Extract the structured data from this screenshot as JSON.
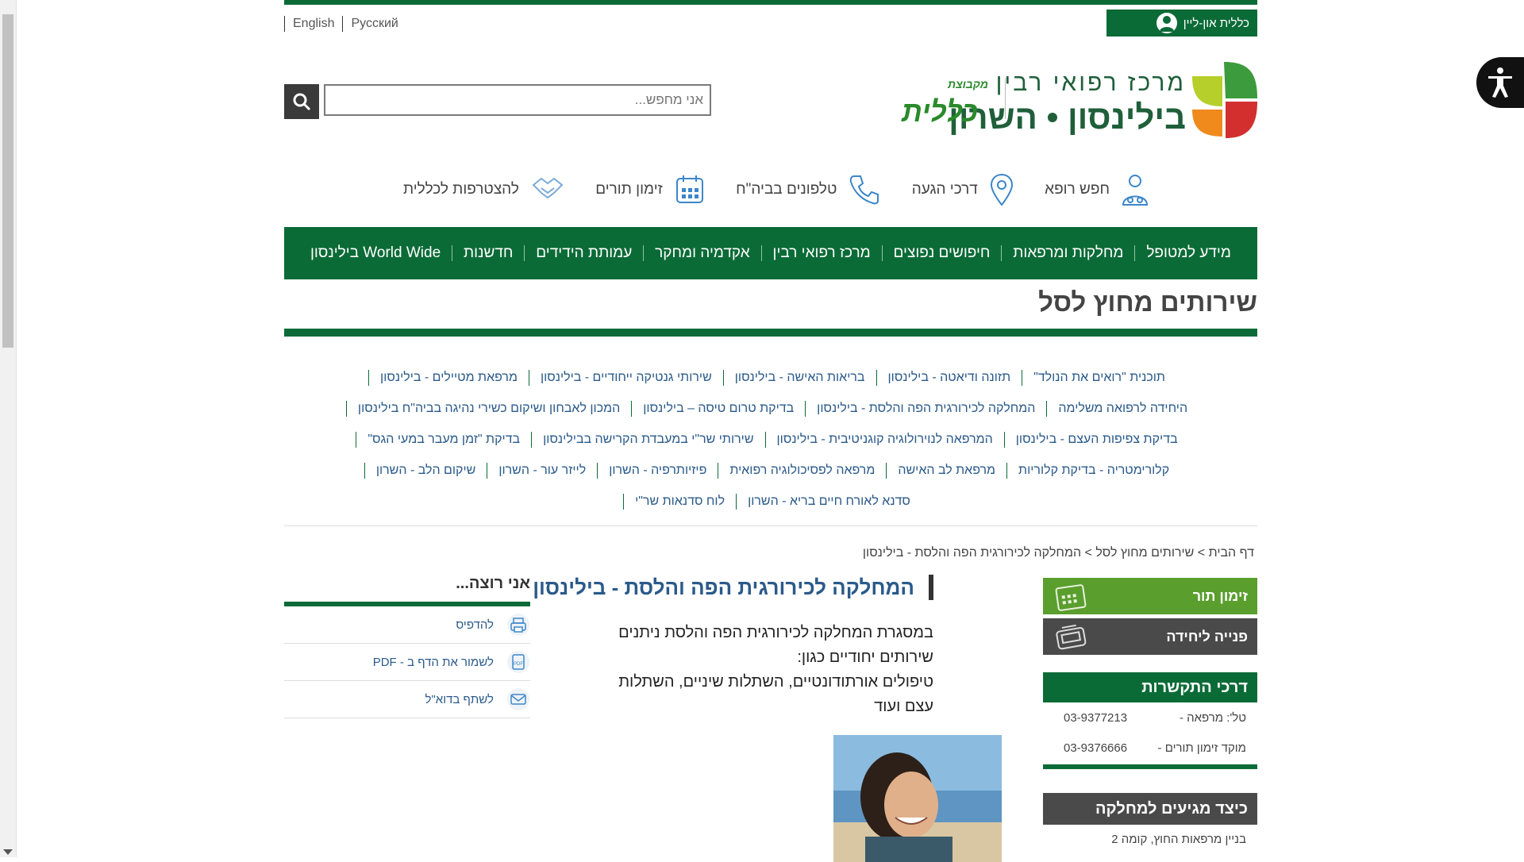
{
  "header": {
    "languages": [
      "English",
      "Русский"
    ],
    "online_label": "כללית און-ליין",
    "logo_line1": "מרכז רפואי רבין",
    "logo_line2": "בילינסון • השרון",
    "clalit_group_small": "מקבוצת",
    "clalit_name": "כללית",
    "search_placeholder": "אני מחפש..."
  },
  "quicklinks": [
    {
      "label": "להצטרפות לכללית",
      "icon": "handshake-icon"
    },
    {
      "label": "זימון תורים",
      "icon": "calendar-icon"
    },
    {
      "label": "טלפונים בביה\"ח",
      "icon": "phone-icon"
    },
    {
      "label": "דרכי הגעה",
      "icon": "location-pin-icon"
    },
    {
      "label": "חפש רופא",
      "icon": "doctor-icon"
    }
  ],
  "nav": [
    "מידע למטופל",
    "מחלקות ומרפאות",
    "חיפושים נפוצים",
    "מרכז רפואי רבין",
    "אקדמיה ומחקר",
    "עמותת הידידים",
    "חדשנות",
    "בילינסון World Wide"
  ],
  "section_title": "שירותים מחוץ לסל",
  "services": [
    [
      "תוכנית \"רואים את הנולד\"",
      "תזונה ודיאטה - בילינסון",
      "בריאות האישה - בילינסון",
      "שירותי גנטיקה ייחודיים - בילינסון",
      "מרפאת מטיילים - בילינסון"
    ],
    [
      "היחידה לרפואה משלימה",
      "המחלקה לכירורגית הפה והלסת - בילינסון",
      "בדיקת טרום טיסה – בילינסון",
      "המכון לאבחון ושיקום כשירי נהיגה בביה\"ח בילינסון"
    ],
    [
      "בדיקת צפיפות העצם - בילינסון",
      "המרפאה לנוירולוגיה קוגניטיבית - בילינסון",
      "שירותי שר\"י במעבדת הקרישה בבילינסון",
      "בדיקת \"זמן מעבר במעי הגס\""
    ],
    [
      "קלורימטריה - בדיקת קלוריות",
      "מרפאת לב האישה",
      "מרפאה לפסיכולוגיה רפואית",
      "פיזיותרפיה - השרון",
      "לייזר עור - השרון",
      "שיקום הלב - השרון"
    ],
    [
      "סדנא לאורח חיים בריא - השרון",
      "לוח סדנאות שר\"י"
    ]
  ],
  "breadcrumb": "דף הבית > שירותים מחוץ לסל > המחלקה לכירורגית הפה והלסת - בילינסון",
  "sidebar_right": {
    "appointment_label": "זימון תור",
    "contact_unit_label": "פנייה ליחידה",
    "contact_title": "דרכי התקשרות",
    "contacts": [
      {
        "label": "טל': מרפאה -",
        "value": "03-9377213"
      },
      {
        "label": "מוקד זימון תורים -",
        "value": "03-9376666"
      }
    ],
    "arrive_title": "כיצד מגיעים למחלקה",
    "arrive_text": "בניין מרפאות החוץ, קומה 2"
  },
  "content": {
    "title": "המחלקה לכירורגית הפה והלסת - בילינסון",
    "para1": "במסגרת המחלקה לכירורגית הפה והלסת ניתנים שירותים יחודיים כגון:",
    "para2": "טיפולים אורתודונטיים, השתלות שיניים, השתלות עצם ועוד"
  },
  "sidebar_left": {
    "title": "אני רוצה...",
    "items": [
      {
        "label": "להדפיס",
        "icon": "printer-icon"
      },
      {
        "label": "לשמור את הדף ב - PDF",
        "icon": "pdf-icon"
      },
      {
        "label": "לשתף בדוא\"ל",
        "icon": "envelope-icon"
      }
    ]
  },
  "colors": {
    "primary_green": "#0b6b37",
    "light_green": "#5a9e2e",
    "link_blue": "#2a5a8a",
    "dark_gray": "#4a4a4a"
  }
}
